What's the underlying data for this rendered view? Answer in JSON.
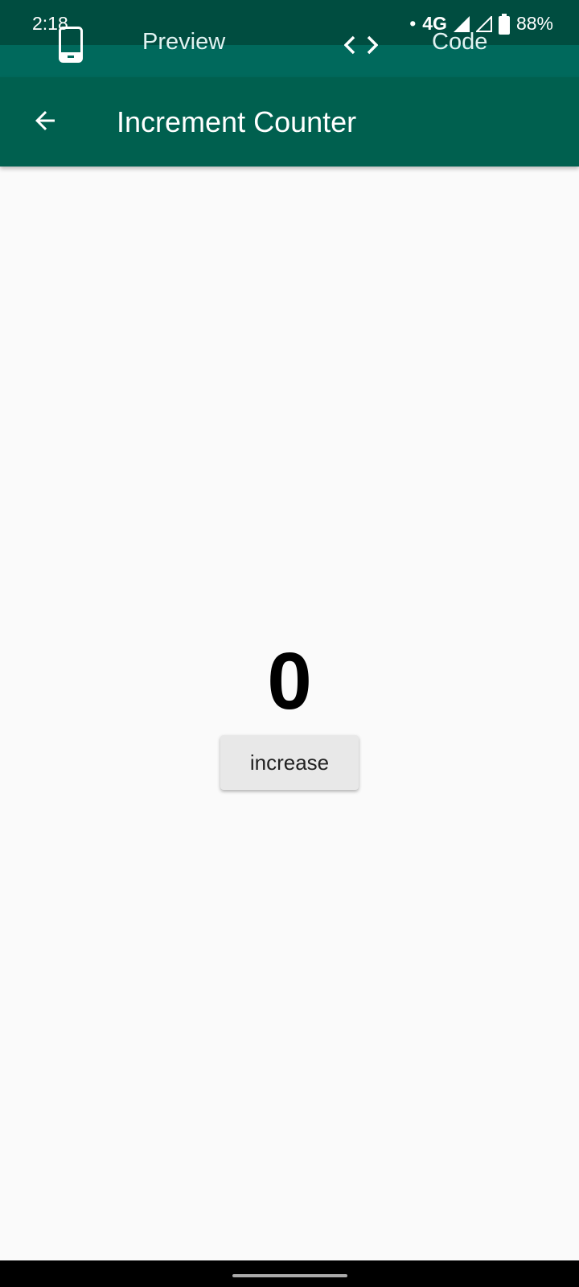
{
  "status_bar": {
    "time": "2:18",
    "network": "4G",
    "battery": "88%"
  },
  "tabs": [
    {
      "label": "Preview",
      "icon": "phone-icon"
    },
    {
      "label": "Code",
      "icon": "code-icon"
    }
  ],
  "app_bar": {
    "title": "Increment Counter",
    "back_icon": "arrow-back-icon"
  },
  "main": {
    "counter_value": "0",
    "increase_label": "increase"
  },
  "colors": {
    "status_bar": "#004d40",
    "primary": "#00695c",
    "background": "#fafafa"
  }
}
